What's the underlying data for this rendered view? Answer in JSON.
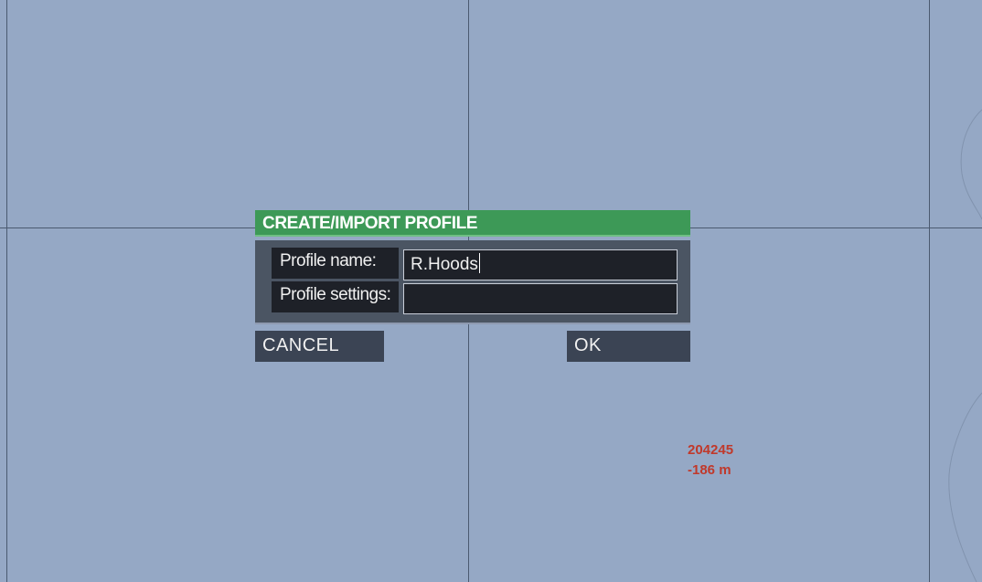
{
  "dialog": {
    "title": "CREATE/IMPORT PROFILE",
    "fields": {
      "name_label": "Profile name:",
      "name_value": "R.Hoods",
      "settings_label": "Profile settings:",
      "settings_value": ""
    },
    "buttons": {
      "cancel_label": "CANCEL",
      "ok_label": "OK"
    }
  },
  "map": {
    "grid_reference": "204245",
    "elevation": "-186 m"
  },
  "colors": {
    "map_background": "#95a8c5",
    "title_bar": "#3d9957",
    "panel": "#4b5563",
    "field": "#1e2128",
    "button": "#3b4454",
    "readout_text": "#c0392b"
  }
}
